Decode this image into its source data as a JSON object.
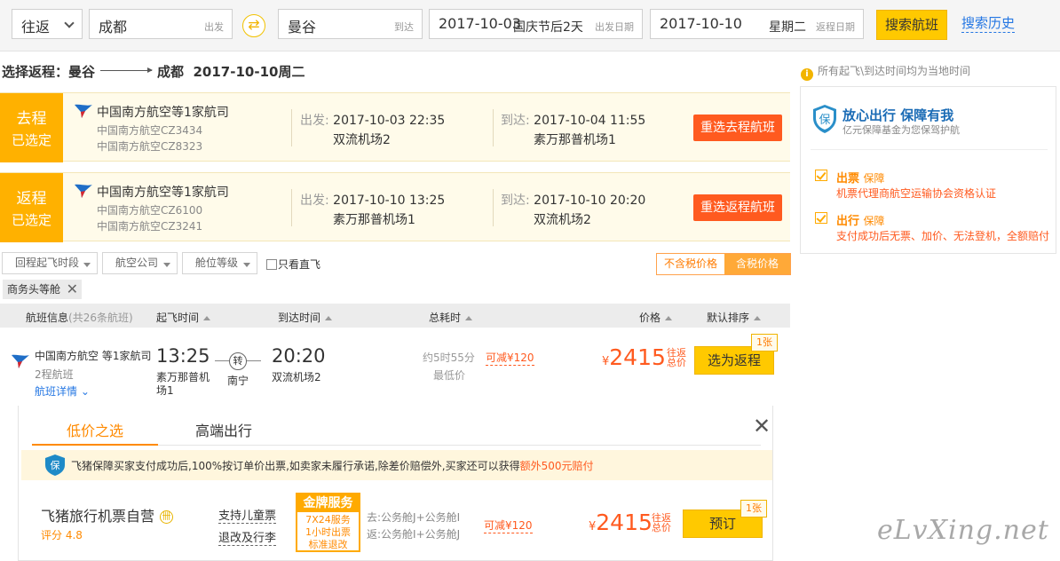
{
  "search": {
    "trip_type": "往返",
    "from_city": "成都",
    "from_hint": "出发",
    "to_city": "曼谷",
    "to_hint": "到达",
    "depart_date": "2017-10-03",
    "depart_note": "国庆节后2天",
    "depart_hint": "出发日期",
    "return_date": "2017-10-10",
    "return_weekday": "星期二",
    "return_hint": "返程日期",
    "search_btn": "搜索航班",
    "history_link": "搜索历史",
    "swap_icon": "swap-icon"
  },
  "heading": {
    "prefix": "选择返程：",
    "from": "曼谷",
    "to": "成都",
    "date": "2017-10-10周二"
  },
  "outbound": {
    "tag1": "去程",
    "tag2": "已选定",
    "airline": "中国南方航空等1家航司",
    "flight1": "中国南方航空CZ3434",
    "flight2": "中国南方航空CZ8323",
    "dep_label": "出发:",
    "dep_time": "2017-10-03 22:35",
    "dep_airport": "双流机场2",
    "arr_label": "到达:",
    "arr_time": "2017-10-04 11:55",
    "arr_airport": "素万那普机场1",
    "reselect": "重选去程航班"
  },
  "inbound": {
    "tag1": "返程",
    "tag2": "已选定",
    "airline": "中国南方航空等1家航司",
    "flight1": "中国南方航空CZ6100",
    "flight2": "中国南方航空CZ3241",
    "dep_label": "出发:",
    "dep_time": "2017-10-10 13:25",
    "dep_airport": "素万那普机场1",
    "arr_label": "到达:",
    "arr_time": "2017-10-10 20:20",
    "arr_airport": "双流机场2",
    "reselect": "重选返程航班"
  },
  "filters": {
    "f1": "回程起飞时段",
    "f2": "航空公司",
    "f3": "舱位等级",
    "direct": "只看直飞",
    "tax_excl": "不含税价格",
    "tax_incl": "含税价格",
    "chip": "商务头等舱"
  },
  "table_head": {
    "info": "航班信息",
    "count": "(共26条航班)",
    "dep": "起飞时间",
    "arr": "到达时间",
    "duration": "总耗时",
    "price": "价格",
    "sort": "默认排序"
  },
  "row": {
    "airline": "中国南方航空 等1家航司",
    "legs": "2程航班",
    "detail": "航班详情",
    "dep_time": "13:25",
    "dep_airport": "素万那普机场1",
    "transfer": "转",
    "transfer_city": "南宁",
    "arr_time": "20:20",
    "arr_airport": "双流机场2",
    "duration": "约5时55分",
    "lowest": "最低价",
    "discount": "可减¥120",
    "currency": "¥",
    "price": "2415",
    "tax_note": "往返总价",
    "select_btn": "选为返程",
    "qty": "1张"
  },
  "panel": {
    "tab1": "低价之选",
    "tab2": "高端出行",
    "close": "✕",
    "guarantee": "飞猪保障买家支付成功后,100%按订单价出票,如卖家未履行承诺,除差价赔偿外,买家还可以获得",
    "guarantee_red": "额外500元赔付",
    "vendor": "飞猪旅行机票自营",
    "rating": "评分 4.8",
    "svc1": "支持儿童票",
    "svc2": "退改及行李",
    "gold_title": "金牌服务",
    "gold1": "7X24服务",
    "gold2": "1小时出票",
    "gold3": "标准退改",
    "cabin1": "去:公务舱J+公务舱I",
    "cabin2": "返:公务舱I+公务舱J",
    "discount": "可减¥120",
    "currency": "¥",
    "price": "2415",
    "tax_note": "往返总价",
    "book_btn": "预订",
    "qty": "1张"
  },
  "sidebar": {
    "note": "所有起飞\\到达时间均为当地时间",
    "title": "放心出行 保障有我",
    "subtitle": "亿元保障基金为您保驾护航",
    "item1_title": "出票",
    "item1_tag": "保障",
    "item1_desc": "机票代理商航空运输协会资格认证",
    "item2_title": "出行",
    "item2_tag": "保障",
    "item2_desc": "支付成功后无票、加价、无法登机，全额赔付"
  },
  "watermark": "eLvXing.net",
  "colors": {
    "accent": "#ffc900",
    "orange": "#ff5a1f",
    "link": "#2577e3"
  }
}
